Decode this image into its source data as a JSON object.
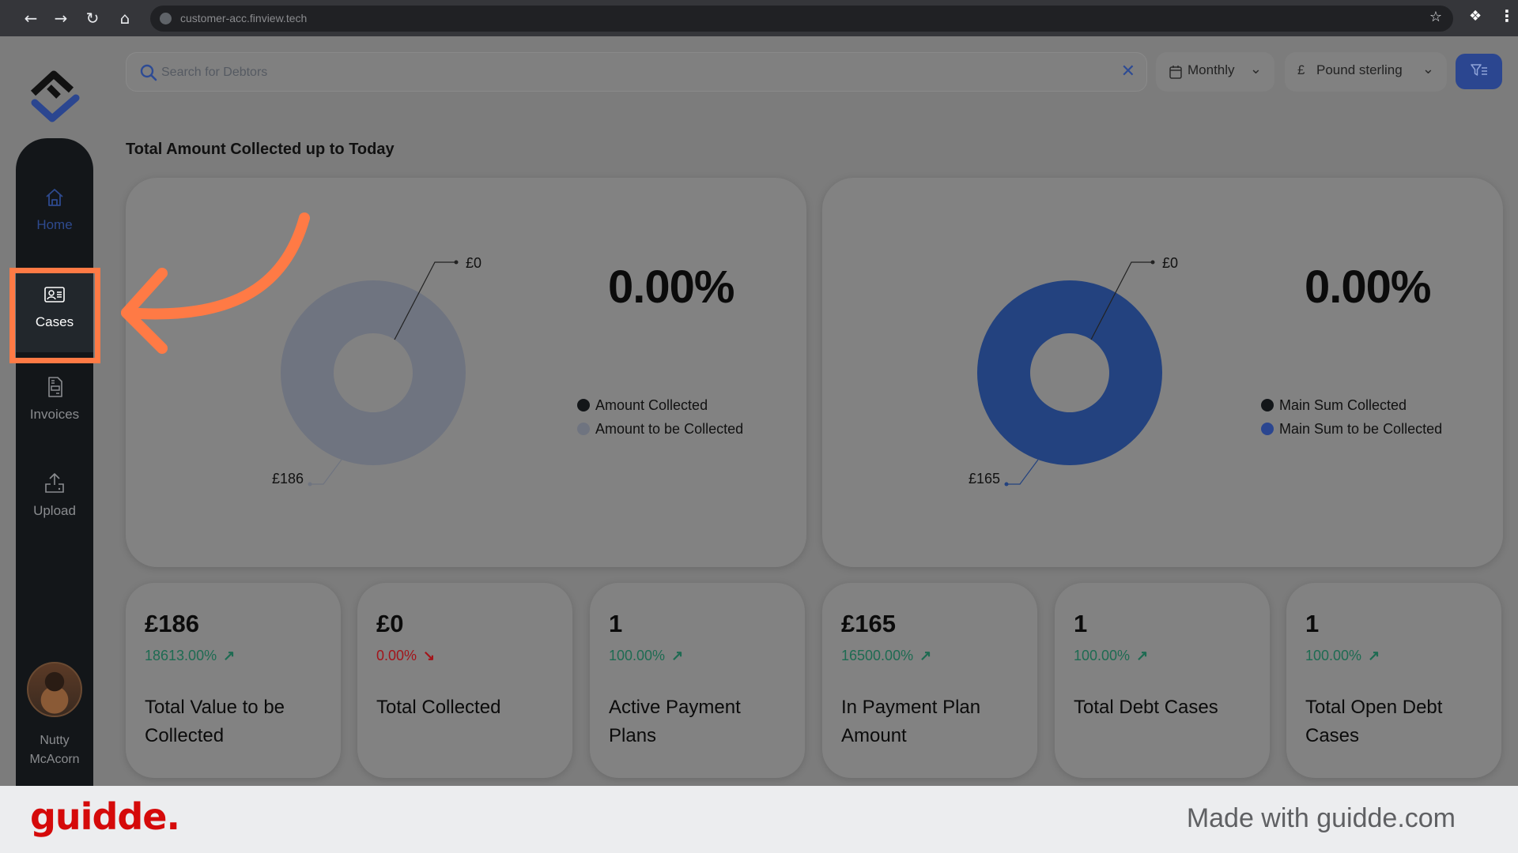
{
  "browser": {
    "url": "customer-acc.finview.tech",
    "icons": [
      "back-icon",
      "forward-icon",
      "reload-icon",
      "home-icon",
      "globe-icon",
      "bookmark-star-icon",
      "extensions-icon",
      "menu-icon"
    ]
  },
  "sidebar": {
    "items": [
      {
        "label": "Home",
        "icon": "home-icon",
        "active": true
      },
      {
        "label": "Cases",
        "icon": "id-card-icon",
        "highlighted": true
      },
      {
        "label": "Invoices",
        "icon": "document-icon"
      },
      {
        "label": "Upload",
        "icon": "upload-icon"
      }
    ],
    "user": {
      "name_line1": "Nutty",
      "name_line2": "McAcorn"
    }
  },
  "search": {
    "placeholder": "Search for Debtors",
    "value": ""
  },
  "filters": {
    "period": "Monthly",
    "currency_symbol": "£",
    "currency": "Pound sterling"
  },
  "section_title": "Total Amount Collected up to Today",
  "colors": {
    "accent_blue": "#23427f",
    "collected_dark": "#131619",
    "to_collect_grey": "#6f7480",
    "up_green": "#1e6b52",
    "down_red": "#a3141a",
    "annotation_orange": "#ff7a45",
    "brand_red": "#d50a0a"
  },
  "chart_data": [
    {
      "type": "pie",
      "variant": "donut",
      "title": "",
      "center_stat": "0.00%",
      "categories": [
        "Amount Collected",
        "Amount to be Collected"
      ],
      "values": [
        0,
        186
      ],
      "labels": [
        "£0",
        "£186"
      ],
      "colors": [
        "#131619",
        "#6f7480"
      ],
      "legend": "right"
    },
    {
      "type": "pie",
      "variant": "donut",
      "title": "",
      "center_stat": "0.00%",
      "categories": [
        "Main Sum Collected",
        "Main Sum to be Collected"
      ],
      "values": [
        0,
        165
      ],
      "labels": [
        "£0",
        "£165"
      ],
      "colors": [
        "#131619",
        "#23427f"
      ],
      "legend": "right"
    }
  ],
  "stats": [
    {
      "value": "£186",
      "change": "18613.00%",
      "direction": "up",
      "label": "Total Value to be Collected"
    },
    {
      "value": "£0",
      "change": "0.00%",
      "direction": "down",
      "label": "Total Collected"
    },
    {
      "value": "1",
      "change": "100.00%",
      "direction": "up",
      "label": "Active Payment Plans"
    },
    {
      "value": "£165",
      "change": "16500.00%",
      "direction": "up",
      "label": "In Payment Plan Amount"
    },
    {
      "value": "1",
      "change": "100.00%",
      "direction": "up",
      "label": "Total Debt Cases"
    },
    {
      "value": "1",
      "change": "100.00%",
      "direction": "up",
      "label": "Total Open Debt Cases"
    }
  ],
  "footer": {
    "logo": "guidde.",
    "credit": "Made with guidde.com"
  }
}
